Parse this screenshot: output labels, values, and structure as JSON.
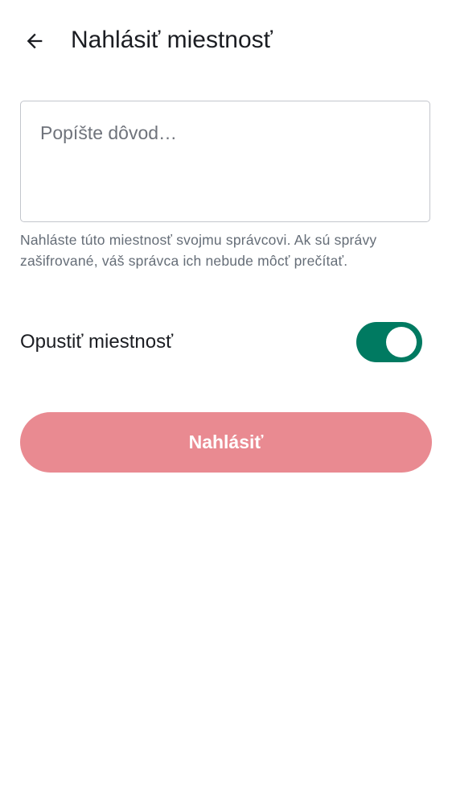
{
  "header": {
    "title": "Nahlásiť miestnosť",
    "back_icon": "arrow-back-icon"
  },
  "reason": {
    "placeholder": "Popíšte dôvod…",
    "value": ""
  },
  "helper_text": "Nahláste túto miestnosť svojmu správcovi. Ak sú správy zašifrované, váš správca ich nebude môcť prečítať.",
  "leave_room": {
    "label": "Opustiť miestnosť",
    "enabled": true
  },
  "report_button": {
    "label": "Nahlásiť"
  },
  "colors": {
    "toggle_on": "#007a61",
    "button_disabled": "#e98a91",
    "helper_text": "#656d77"
  }
}
